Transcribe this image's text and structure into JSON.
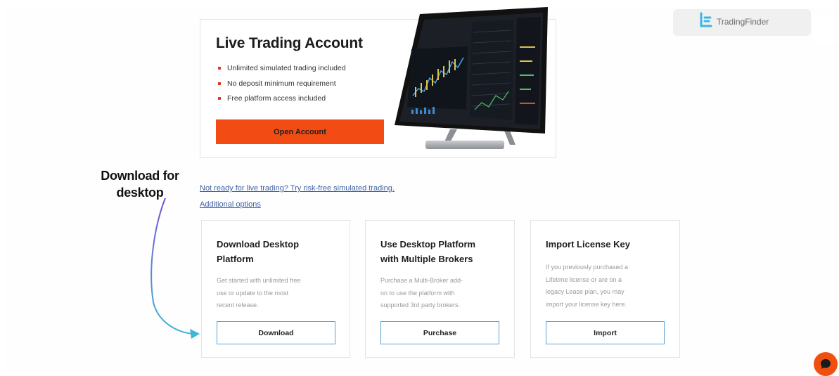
{
  "live_account": {
    "title": "Live Trading Account",
    "bullets": [
      "Unlimited simulated trading included",
      "No deposit minimum requirement",
      "Free platform access included"
    ],
    "open_button": "Open Account"
  },
  "links": {
    "simulated": "Not ready for live trading? Try risk-free simulated trading.",
    "additional": "Additional options"
  },
  "annotation": {
    "line1": "Download for",
    "line2": "desktop"
  },
  "options": [
    {
      "title_line1": "Download Desktop",
      "title_line2": "Platform",
      "desc": [
        "Get started with unlimited free",
        "use or update to the most",
        "recent release."
      ],
      "button": "Download"
    },
    {
      "title_line1": "Use Desktop Platform",
      "title_line2": "with Multiple Brokers",
      "desc": [
        "Purchase a Multi-Broker add-",
        "on to use the platform with",
        "supported 3rd party brokers."
      ],
      "button": "Purchase"
    },
    {
      "title_line1": "Import License Key",
      "title_line2": "",
      "desc": [
        "If you previously purchased a",
        "Lifetime license or are on a",
        "legacy Lease plan, you may",
        "import your license key here."
      ],
      "button": "Import"
    }
  ],
  "watermark": {
    "text": "TradingFinder"
  },
  "colors": {
    "accent": "#f24b13",
    "link": "#3f64a6",
    "button_border": "#5aa3d6",
    "arrow": "#7b4fd6"
  },
  "icons": {
    "chat": "chat-bubble-icon",
    "logo": "tradingfinder-logo-icon"
  }
}
